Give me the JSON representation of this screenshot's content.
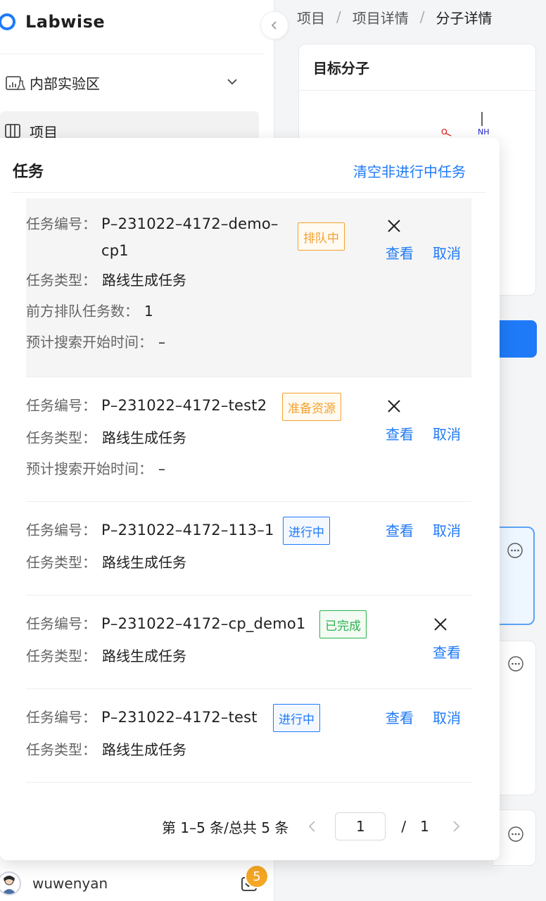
{
  "app": {
    "name": "Labwise",
    "lab_workspace": "内部实验区",
    "nav_project": "项目",
    "username": "wuwenyan",
    "task_count": "5"
  },
  "breadcrumb": [
    "项目",
    "项目详情",
    "分子详情"
  ],
  "molecule_card": {
    "title": "目标分子",
    "atom_o": "O",
    "atom_nh": "NH"
  },
  "tasks_panel": {
    "title": "任务",
    "clear_label": "清空非进行中任务",
    "labels": {
      "id": "任务编号：",
      "type": "任务类型：",
      "queue_ahead": "前方排队任务数：",
      "est_start": "预计搜索开始时间："
    },
    "view_label": "查看",
    "cancel_label": "取消",
    "tasks": [
      {
        "id_line1": "P–231022–4172–demo–",
        "id_line2": "cp1",
        "status": "排队中",
        "type": "路线生成任务",
        "queue_ahead": "1",
        "est_start": "–"
      },
      {
        "id_line1": "P–231022–4172–test2",
        "status": "准备资源",
        "type": "路线生成任务",
        "est_start": "–"
      },
      {
        "id_line1": "P–231022–4172–113–1",
        "status": "进行中",
        "type": "路线生成任务"
      },
      {
        "id_line1": "P–231022–4172–cp_demo1",
        "status": "已完成",
        "type": "路线生成任务"
      },
      {
        "id_line1": "P–231022–4172–test",
        "status": "进行中",
        "type": "路线生成任务"
      }
    ],
    "pagination": {
      "summary": "第 1–5 条/总共 5 条",
      "current": "1",
      "separator": "/",
      "total_pages": "1"
    }
  },
  "colors": {
    "primary": "#1f7af7",
    "queue": "#f5a02e",
    "running": "#1f7af7",
    "done": "#2bb24c",
    "badge_count": "#f5a623"
  }
}
